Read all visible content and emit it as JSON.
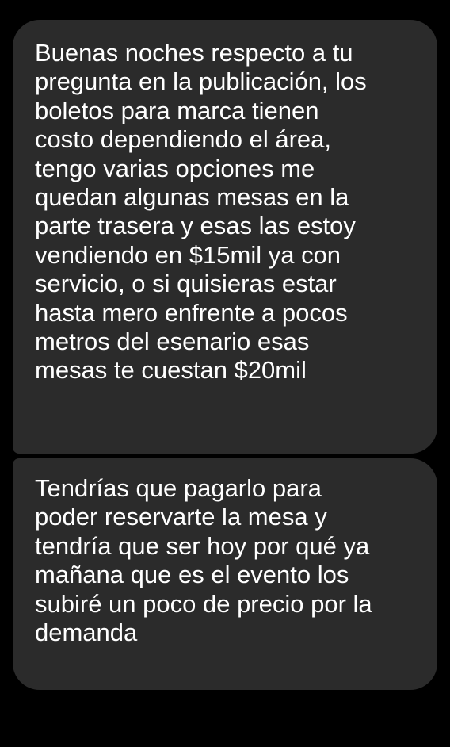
{
  "messages": [
    {
      "lines": [
        "Buenas noches respecto a tu",
        "pregunta en la publicación, los",
        "boletos para marca tienen",
        "costo dependiendo el área,",
        "tengo varias opciones me",
        "quedan algunas mesas en la",
        "parte trasera y esas las estoy",
        "vendiendo en $15mil ya con",
        "servicio, o si quisieras estar",
        "hasta mero enfrente a pocos",
        "metros del esenario esas",
        "mesas te cuestan $20mil"
      ]
    },
    {
      "lines": [
        "Tendrías que pagarlo para",
        "poder reservarte la mesa y",
        "tendría que ser hoy por qué ya",
        "mañana que es el evento los",
        "subiré un poco de precio por la",
        "demanda"
      ]
    }
  ],
  "colors": {
    "background": "#000000",
    "bubble": "#2b2b2b",
    "text": "#ffffff"
  }
}
